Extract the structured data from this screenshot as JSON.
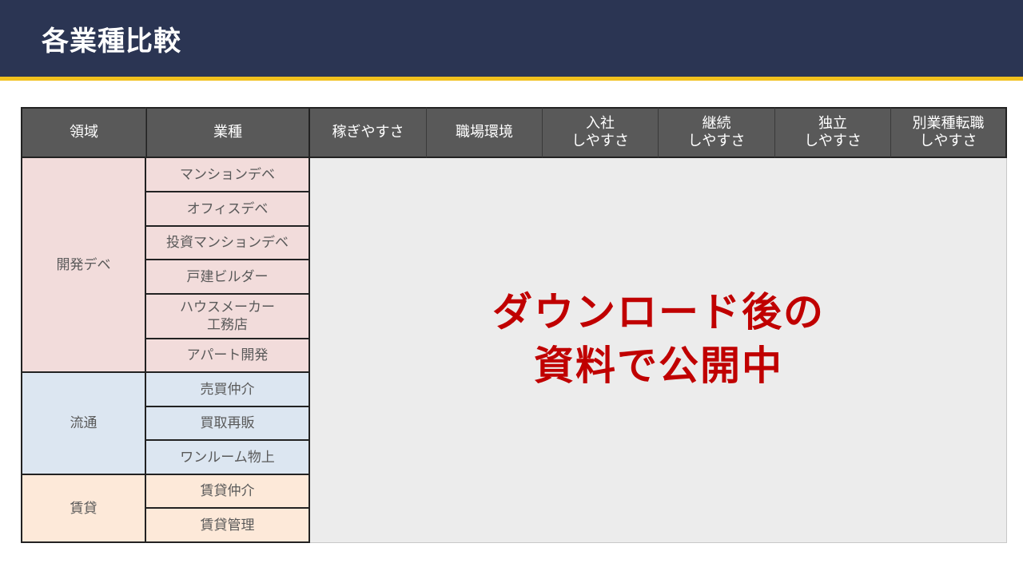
{
  "slide": {
    "title": "各業種比較"
  },
  "table": {
    "headers": {
      "domain": "領域",
      "industry": "業種",
      "earn": "稼ぎやすさ",
      "workplace": "職場環境",
      "entry": [
        "入社",
        "しやすさ"
      ],
      "continue": [
        "継続",
        "しやすさ"
      ],
      "independence": [
        "独立",
        "しやすさ"
      ],
      "transfer": [
        "別業種転職",
        "しやすさ"
      ]
    },
    "domains": {
      "dev": "開発デベ",
      "distribution": "流通",
      "rental": "賃貸"
    },
    "industries": {
      "mansion_dev": "マンションデベ",
      "office_dev": "オフィスデベ",
      "investment_mansion_dev": "投資マンションデベ",
      "house_builder": "戸建ビルダー",
      "house_maker": [
        "ハウスメーカー",
        "工務店"
      ],
      "apartment_dev": "アパート開発",
      "brokerage": "売買仲介",
      "resale": "買取再販",
      "one_room": "ワンルーム物上",
      "rental_brokerage": "賃貸仲介",
      "rental_management": "賃貸管理"
    },
    "notice": [
      "ダウンロード後の",
      "資料で公開中"
    ]
  }
}
